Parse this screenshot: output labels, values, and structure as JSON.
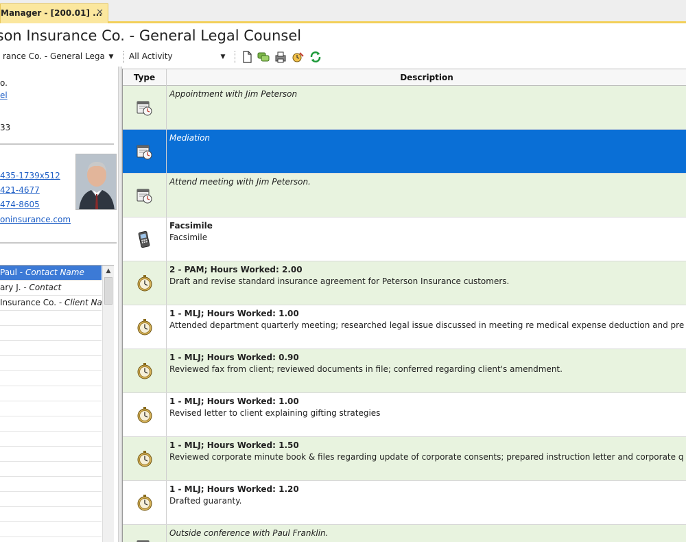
{
  "tab": {
    "label": "Manager - [200.01] ...",
    "close": "✕"
  },
  "heading": "rson Insurance Co. - General Legal Counsel",
  "toolbar": {
    "matter_combo": "rance Co. - General Legal",
    "filter_combo": "All Activity",
    "icons": [
      "new-document-icon",
      "notes-icon",
      "print-icon",
      "time-entry-icon",
      "refresh-icon"
    ]
  },
  "left_panel": {
    "line1": "o.",
    "link1": "el",
    "line3": "33",
    "phone1": "435-1739x512",
    "phone2": "421-4677",
    "phone3": "474-8605",
    "email": "oninsurance.com",
    "list": [
      {
        "text": "Paul - ",
        "role": "Contact Name",
        "selected": true
      },
      {
        "text": "ary J. - ",
        "role": "Contact",
        "selected": false
      },
      {
        "text": " Insurance Co. - ",
        "role": "Client Na",
        "selected": false
      }
    ]
  },
  "grid": {
    "headers": {
      "type": "Type",
      "description": "Description"
    },
    "rows": [
      {
        "icon": "calendar-icon",
        "style": "green",
        "italic": "Appointment with Jim Peterson"
      },
      {
        "icon": "calendar-icon",
        "style": "blue",
        "italic": "Mediation"
      },
      {
        "icon": "calendar-icon",
        "style": "green",
        "italic": "Attend meeting with Jim Peterson."
      },
      {
        "icon": "fax-icon",
        "style": "white",
        "title": "Facsimile",
        "body": "Facsimile"
      },
      {
        "icon": "stopwatch-icon",
        "style": "green",
        "title": "2 - PAM;  Hours Worked:  2.00",
        "body": "Draft and revise standard insurance agreement for Peterson Insurance customers."
      },
      {
        "icon": "stopwatch-icon",
        "style": "white",
        "title": "1 - MLJ;  Hours Worked:  1.00",
        "body": "Attended department quarterly meeting; researched legal issue discussed in meeting re medical expense deduction and prepared"
      },
      {
        "icon": "stopwatch-icon",
        "style": "green",
        "title": "1 - MLJ;  Hours Worked:  0.90",
        "body": "Reviewed fax from client; reviewed documents in file; conferred regarding client's amendment."
      },
      {
        "icon": "stopwatch-icon",
        "style": "white",
        "title": "1 - MLJ;  Hours Worked:  1.00",
        "body": "Revised letter to client explaining gifting strategies"
      },
      {
        "icon": "stopwatch-icon",
        "style": "green",
        "title": "1 - MLJ;  Hours Worked:  1.50",
        "body": "Reviewed corporate minute book & files regarding update of corporate consents; prepared instruction letter and corporate ques"
      },
      {
        "icon": "stopwatch-icon",
        "style": "white",
        "title": "1 - MLJ;  Hours Worked:  1.20",
        "body": "Drafted guaranty."
      },
      {
        "icon": "calendar-icon",
        "style": "green",
        "italic": "Outside conference with Paul Franklin."
      }
    ]
  }
}
